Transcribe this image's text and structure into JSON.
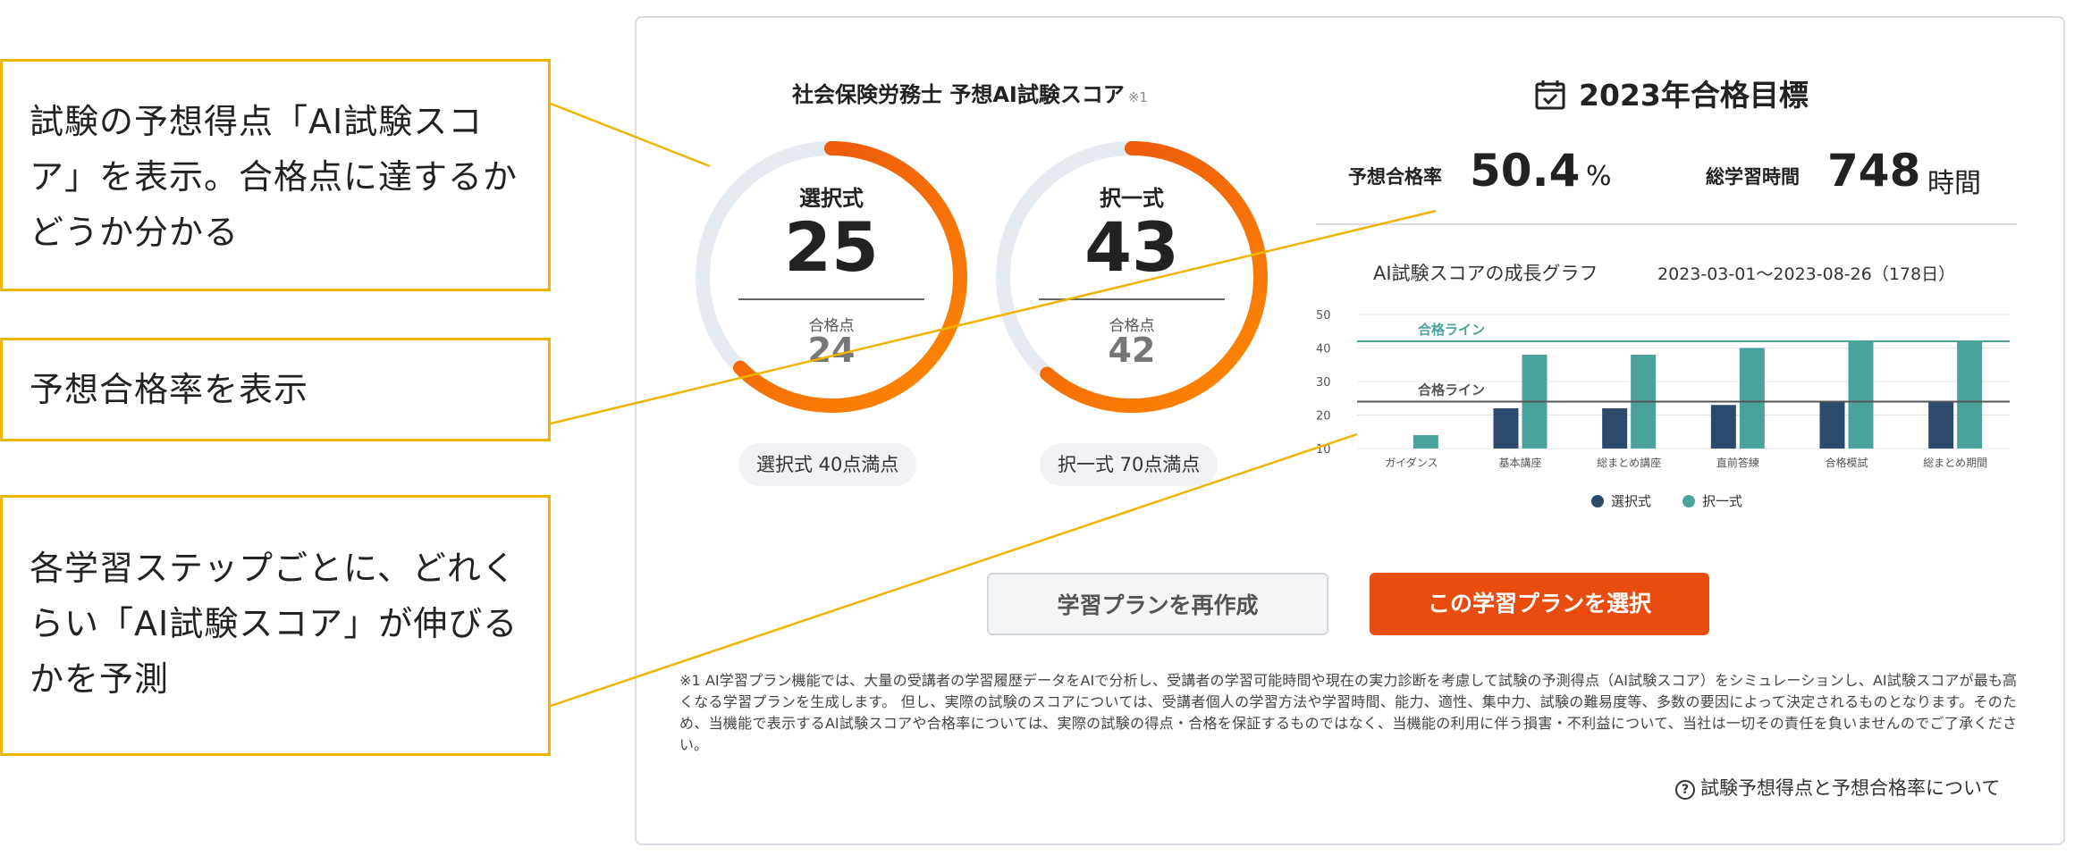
{
  "callouts": [
    {
      "text": "試験の予想得点「AI試験スコア」を表示。合格点に達するかどうか分かる"
    },
    {
      "text": "予想合格率を表示"
    },
    {
      "text": "各学習ステップごとに、どれくらい「AI試験スコア」が伸びるかを予測"
    }
  ],
  "score": {
    "title": "社会保険労務士 予想AI試験スコア",
    "note": "※1",
    "gauges": [
      {
        "label": "選択式",
        "score": "25",
        "pass_label": "合格点",
        "pass": "24",
        "max_text": "選択式 40点満点",
        "progress": 0.625
      },
      {
        "label": "択一式",
        "score": "43",
        "pass_label": "合格点",
        "pass": "42",
        "max_text": "択一式 70点満点",
        "progress": 0.614
      }
    ],
    "colors": {
      "ring_bg": "#e6ebf2",
      "ring_from": "#ff8a00",
      "ring_to": "#e84c0e"
    }
  },
  "goal": {
    "title": "2023年合格目標",
    "icon": "calendar-check-icon",
    "rate_label": "予想合格率",
    "rate_value": "50.4",
    "rate_unit": "%",
    "hours_label": "総学習時間",
    "hours_value": "748",
    "hours_unit": "時間"
  },
  "chart_title": "AI試験スコアの成長グラフ",
  "chart_period": "2023-03-01〜2023-08-26（178日）",
  "chart_data": {
    "type": "bar",
    "categories": [
      "ガイダンス",
      "基本講座",
      "総まとめ講座",
      "直前答練",
      "合格模試",
      "総まとめ期間"
    ],
    "series": [
      {
        "name": "選択式",
        "color": "#2c4a6b",
        "values": [
          null,
          22,
          22,
          23,
          24,
          24
        ]
      },
      {
        "name": "択一式",
        "color": "#4aa39a",
        "values": [
          14,
          38,
          38,
          40,
          42,
          42
        ]
      }
    ],
    "ylim": [
      10,
      50
    ],
    "yticks": [
      10,
      20,
      30,
      40,
      50
    ],
    "reference_lines": [
      {
        "label": "合格ライン",
        "value": 42,
        "color": "#4aa39a"
      },
      {
        "label": "合格ライン",
        "value": 24,
        "color": "#555555"
      }
    ],
    "legend": "bottom"
  },
  "buttons": {
    "recreate": "学習プランを再作成",
    "select": "この学習プランを選択"
  },
  "disclaimer": "※1 AI学習プラン機能では、大量の受講者の学習履歴データをAIで分析し、受講者の学習可能時間や現在の実力診断を考慮して試験の予測得点（AI試験スコア）をシミュレーションし、AI試験スコアが最も高くなる学習プランを生成します。 但し、実際の試験のスコアについては、受講者個人の学習方法や学習時間、能力、適性、集中力、試験の難易度等、多数の要因によって決定されるものとなります。そのため、当機能で表示するAI試験スコアや合格率については、実際の試験の得点・合格を保証するものではなく、当機能の利用に伴う損害・不利益について、当社は一切その責任を負いませんのでご了承ください。",
  "help_link": "試験予想得点と予想合格率について"
}
